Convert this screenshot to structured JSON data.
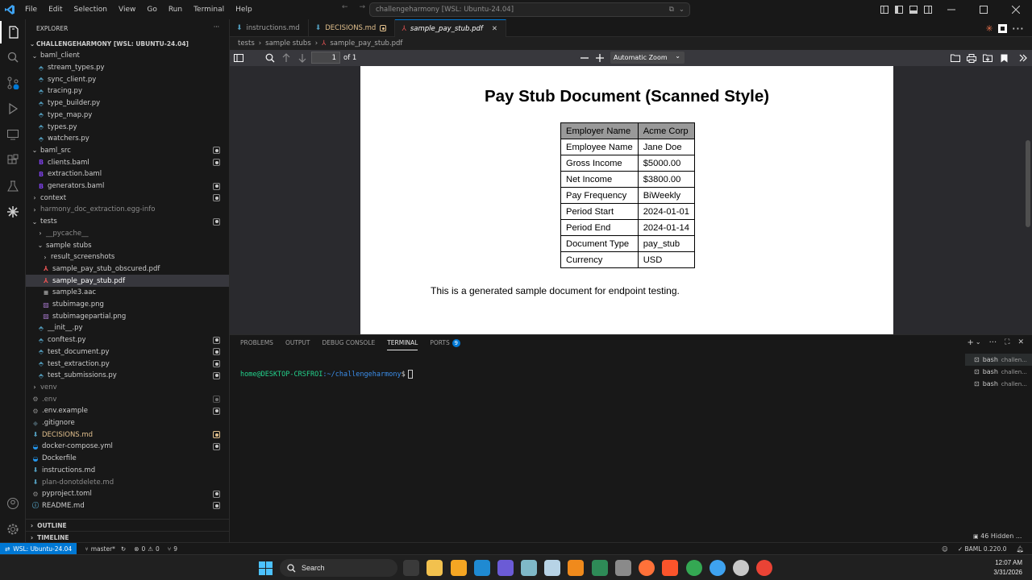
{
  "titlebar": {
    "menu": [
      "File",
      "Edit",
      "Selection",
      "View",
      "Go",
      "Run",
      "Terminal",
      "Help"
    ],
    "command_center": "challengeharmony [WSL: Ubuntu-24.04]"
  },
  "sidebar": {
    "title": "EXPLORER",
    "project": "CHALLENGEHARMONY [WSL: UBUNTU-24.04]",
    "items": [
      {
        "label": "baml_client",
        "depth": 0,
        "type": "folder-open",
        "color": "#cccccc",
        "dot": ""
      },
      {
        "label": "stream_types.py",
        "depth": 1,
        "type": "py",
        "color": "#cccccc",
        "dot": ""
      },
      {
        "label": "sync_client.py",
        "depth": 1,
        "type": "py",
        "color": "#cccccc",
        "dot": ""
      },
      {
        "label": "tracing.py",
        "depth": 1,
        "type": "py",
        "color": "#cccccc",
        "dot": ""
      },
      {
        "label": "type_builder.py",
        "depth": 1,
        "type": "py",
        "color": "#cccccc",
        "dot": ""
      },
      {
        "label": "type_map.py",
        "depth": 1,
        "type": "py",
        "color": "#cccccc",
        "dot": ""
      },
      {
        "label": "types.py",
        "depth": 1,
        "type": "py",
        "color": "#cccccc",
        "dot": ""
      },
      {
        "label": "watchers.py",
        "depth": 1,
        "type": "py",
        "color": "#cccccc",
        "dot": ""
      },
      {
        "label": "baml_src",
        "depth": 0,
        "type": "folder-open",
        "color": "#cccccc",
        "dot": "u"
      },
      {
        "label": "clients.baml",
        "depth": 1,
        "type": "baml",
        "color": "#cccccc",
        "dot": "u"
      },
      {
        "label": "extraction.baml",
        "depth": 1,
        "type": "baml",
        "color": "#cccccc",
        "dot": ""
      },
      {
        "label": "generators.baml",
        "depth": 1,
        "type": "baml",
        "color": "#cccccc",
        "dot": "u"
      },
      {
        "label": "context",
        "depth": 0,
        "type": "folder",
        "color": "#cccccc",
        "dot": "u"
      },
      {
        "label": "harmony_doc_extraction.egg-info",
        "depth": 0,
        "type": "folder",
        "color": "#8c8c8c",
        "dot": ""
      },
      {
        "label": "tests",
        "depth": 0,
        "type": "folder-open",
        "color": "#cccccc",
        "dot": "u"
      },
      {
        "label": "__pycache__",
        "depth": 1,
        "type": "folder",
        "color": "#8c8c8c",
        "dot": ""
      },
      {
        "label": "sample stubs",
        "depth": 1,
        "type": "folder-open",
        "color": "#cccccc",
        "dot": ""
      },
      {
        "label": "result_screenshots",
        "depth": 2,
        "type": "folder",
        "color": "#cccccc",
        "dot": ""
      },
      {
        "label": "sample_pay_stub_obscured.pdf",
        "depth": 2,
        "type": "pdf",
        "color": "#cccccc",
        "dot": ""
      },
      {
        "label": "sample_pay_stub.pdf",
        "depth": 2,
        "type": "pdf",
        "color": "#ffffff",
        "dot": "",
        "selected": true
      },
      {
        "label": "sample3.aac",
        "depth": 2,
        "type": "txt",
        "color": "#cccccc",
        "dot": ""
      },
      {
        "label": "stubimage.png",
        "depth": 2,
        "type": "img",
        "color": "#cccccc",
        "dot": ""
      },
      {
        "label": "stubimagepartial.png",
        "depth": 2,
        "type": "img",
        "color": "#cccccc",
        "dot": ""
      },
      {
        "label": "__init__.py",
        "depth": 1,
        "type": "py",
        "color": "#cccccc",
        "dot": ""
      },
      {
        "label": "conftest.py",
        "depth": 1,
        "type": "py",
        "color": "#cccccc",
        "dot": "u"
      },
      {
        "label": "test_document.py",
        "depth": 1,
        "type": "py",
        "color": "#cccccc",
        "dot": "u"
      },
      {
        "label": "test_extraction.py",
        "depth": 1,
        "type": "py",
        "color": "#cccccc",
        "dot": "u"
      },
      {
        "label": "test_submissions.py",
        "depth": 1,
        "type": "py",
        "color": "#cccccc",
        "dot": "u"
      },
      {
        "label": "venv",
        "depth": 0,
        "type": "folder",
        "color": "#8c8c8c",
        "dot": ""
      },
      {
        "label": ".env",
        "depth": 0,
        "type": "gear",
        "color": "#8c8c8c",
        "dot": "g"
      },
      {
        "label": ".env.example",
        "depth": 0,
        "type": "gear",
        "color": "#cccccc",
        "dot": "u"
      },
      {
        "label": ".gitignore",
        "depth": 0,
        "type": "git",
        "color": "#cccccc",
        "dot": ""
      },
      {
        "label": "DECISIONS.md",
        "depth": 0,
        "type": "md",
        "color": "#e2c08d",
        "dot": "m"
      },
      {
        "label": "docker-compose.yml",
        "depth": 0,
        "type": "docker",
        "color": "#cccccc",
        "dot": "u"
      },
      {
        "label": "Dockerfile",
        "depth": 0,
        "type": "docker",
        "color": "#cccccc",
        "dot": ""
      },
      {
        "label": "instructions.md",
        "depth": 0,
        "type": "md",
        "color": "#cccccc",
        "dot": ""
      },
      {
        "label": "plan-donotdelete.md",
        "depth": 0,
        "type": "md",
        "color": "#8c8c8c",
        "dot": ""
      },
      {
        "label": "pyproject.toml",
        "depth": 0,
        "type": "gear",
        "color": "#cccccc",
        "dot": "u"
      },
      {
        "label": "README.md",
        "depth": 0,
        "type": "info",
        "color": "#cccccc",
        "dot": "u"
      }
    ],
    "outline": "OUTLINE",
    "timeline": "TIMELINE"
  },
  "editor": {
    "tabs": [
      {
        "label": "instructions.md",
        "type": "md"
      },
      {
        "label": "DECISIONS.md",
        "type": "md",
        "modified": true
      },
      {
        "label": "sample_pay_stub.pdf",
        "type": "pdf",
        "active": true
      }
    ],
    "breadcrumb": [
      "tests",
      "sample stubs",
      "sample_pay_stub.pdf"
    ],
    "pdf_toolbar": {
      "page": "1",
      "page_count": "of 1",
      "zoom": "Automatic Zoom"
    },
    "pdf": {
      "title": "Pay Stub Document (Scanned Style)",
      "rows": [
        [
          "Employer Name",
          "Acme Corp"
        ],
        [
          "Employee Name",
          "Jane Doe"
        ],
        [
          "Gross Income",
          "$5000.00"
        ],
        [
          "Net Income",
          "$3800.00"
        ],
        [
          "Pay Frequency",
          "BiWeekly"
        ],
        [
          "Period Start",
          "2024-01-01"
        ],
        [
          "Period End",
          "2024-01-14"
        ],
        [
          "Document Type",
          "pay_stub"
        ],
        [
          "Currency",
          "USD"
        ]
      ],
      "note": "This is a generated sample document for endpoint testing."
    }
  },
  "panel": {
    "tabs": [
      "PROBLEMS",
      "OUTPUT",
      "DEBUG CONSOLE",
      "TERMINAL",
      "PORTS"
    ],
    "ports_badge": "9",
    "prompt_user": "home@DESKTOP-CRSFROI",
    "prompt_path": ":~/challengeharmony",
    "prompt_symbol": "$",
    "terminals": [
      {
        "name": "bash",
        "sub": "challen..."
      },
      {
        "name": "bash",
        "sub": "challen..."
      },
      {
        "name": "bash",
        "sub": "challen..."
      }
    ],
    "hidden": "46 Hidden ..."
  },
  "statusbar": {
    "remote": "WSL: Ubuntu-24.04",
    "branch": "master*",
    "errors": "0",
    "warnings": "0",
    "ports": "9",
    "baml": "BAML 0.220.0"
  },
  "taskbar": {
    "search": "Search",
    "time": "12:07 AM",
    "date": "3/31/2026"
  },
  "colors": {
    "accent": "#0078d4",
    "modified": "#e2c08d",
    "terminal_user": "#23d18b",
    "terminal_path": "#3b8eea"
  }
}
